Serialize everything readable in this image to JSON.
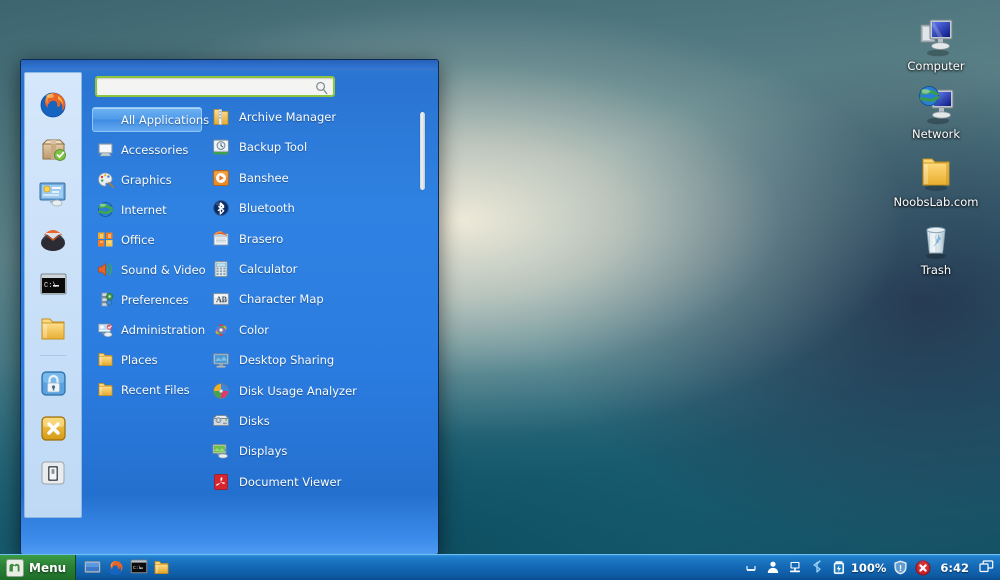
{
  "desktop": {
    "icons": [
      {
        "label": "Computer",
        "icon": "computer-icon"
      },
      {
        "label": "Network",
        "icon": "network-icon"
      },
      {
        "label": "NoobsLab.com",
        "icon": "folder-icon"
      },
      {
        "label": "Trash",
        "icon": "trash-icon"
      }
    ]
  },
  "menu": {
    "search": {
      "value": "",
      "placeholder": "",
      "icon": "search-icon"
    },
    "favorites": [
      {
        "name": "firefox",
        "tooltip": "Firefox Web Browser"
      },
      {
        "name": "software-manager",
        "tooltip": "Software Manager"
      },
      {
        "name": "control-center",
        "tooltip": "System Settings"
      },
      {
        "name": "thunderbird",
        "tooltip": "Mail"
      },
      {
        "name": "terminal",
        "tooltip": "Terminal"
      },
      {
        "name": "files",
        "tooltip": "Files"
      },
      {
        "name": "separator",
        "tooltip": ""
      },
      {
        "name": "lock-screen",
        "tooltip": "Lock Screen"
      },
      {
        "name": "logout",
        "tooltip": "Logout"
      },
      {
        "name": "quit",
        "tooltip": "Quit"
      }
    ],
    "categories": [
      {
        "label": "All Applications",
        "icon": "all-apps-icon",
        "selected": true
      },
      {
        "label": "Accessories",
        "icon": "accessories-icon",
        "selected": false
      },
      {
        "label": "Graphics",
        "icon": "graphics-icon",
        "selected": false
      },
      {
        "label": "Internet",
        "icon": "internet-icon",
        "selected": false
      },
      {
        "label": "Office",
        "icon": "office-icon",
        "selected": false
      },
      {
        "label": "Sound & Video",
        "icon": "sound-video-icon",
        "selected": false
      },
      {
        "label": "Preferences",
        "icon": "preferences-icon",
        "selected": false
      },
      {
        "label": "Administration",
        "icon": "administration-icon",
        "selected": false
      },
      {
        "label": "Places",
        "icon": "places-icon",
        "selected": false
      },
      {
        "label": "Recent Files",
        "icon": "recent-files-icon",
        "selected": false
      }
    ],
    "applications": [
      {
        "label": "Archive Manager",
        "icon": "archive-manager-icon"
      },
      {
        "label": "Backup Tool",
        "icon": "backup-tool-icon"
      },
      {
        "label": "Banshee",
        "icon": "banshee-icon"
      },
      {
        "label": "Bluetooth",
        "icon": "bluetooth-icon"
      },
      {
        "label": "Brasero",
        "icon": "brasero-icon"
      },
      {
        "label": "Calculator",
        "icon": "calculator-icon"
      },
      {
        "label": "Character Map",
        "icon": "character-map-icon"
      },
      {
        "label": "Color",
        "icon": "color-icon"
      },
      {
        "label": "Desktop Sharing",
        "icon": "desktop-sharing-icon"
      },
      {
        "label": "Disk Usage Analyzer",
        "icon": "disk-usage-icon"
      },
      {
        "label": "Disks",
        "icon": "disks-icon"
      },
      {
        "label": "Displays",
        "icon": "displays-icon"
      },
      {
        "label": "Document Viewer",
        "icon": "document-viewer-icon"
      }
    ]
  },
  "taskbar": {
    "menu_button": {
      "label": "Menu",
      "icon": "mint-logo-icon"
    },
    "quicklaunch": [
      {
        "name": "show-desktop-icon"
      },
      {
        "name": "firefox-icon"
      },
      {
        "name": "terminal-icon"
      },
      {
        "name": "files-icon"
      }
    ],
    "tray": [
      {
        "name": "minimize-tray-icon"
      },
      {
        "name": "user-icon"
      },
      {
        "name": "network-tray-icon"
      },
      {
        "name": "bluetooth-tray-icon"
      },
      {
        "name": "battery-icon"
      }
    ],
    "battery_percent": "100%",
    "shield_icon": "update-shield-icon",
    "error_icon": "error-badge-icon",
    "clock": "6:42",
    "workspace_icon": "workspace-switcher-icon"
  },
  "colors": {
    "menu_blue": "#2f82e2",
    "accent_green": "#8cc63f",
    "taskbar_blue": "#1468b4",
    "mint_green": "#2c8237"
  }
}
